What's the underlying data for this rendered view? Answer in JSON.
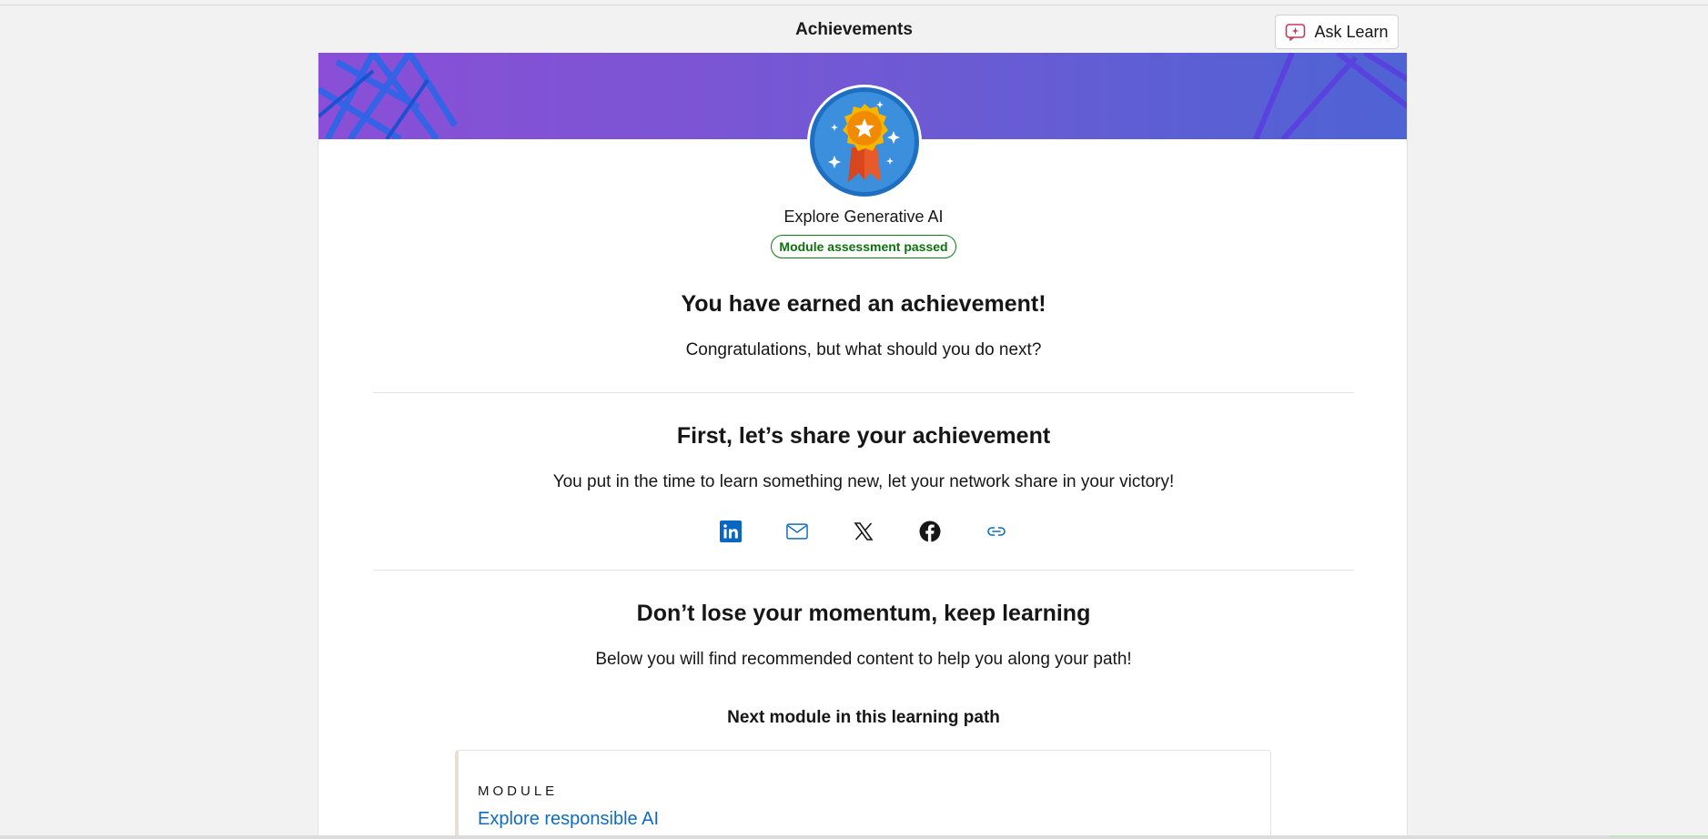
{
  "header": {
    "title": "Achievements",
    "ask_learn_label": "Ask Learn"
  },
  "achievement": {
    "module_name": "Explore Generative AI",
    "status": "Module assessment passed",
    "heading": "You have earned an achievement!",
    "subheading": "Congratulations, but what should you do next?"
  },
  "share": {
    "heading": "First, let’s share your achievement",
    "text": "You put in the time to learn something new, let your network share in your victory!",
    "buttons": [
      {
        "icon": "linkedin-icon",
        "color": "#0a66c2"
      },
      {
        "icon": "mail-icon",
        "color": "#0f6cbd"
      },
      {
        "icon": "x-icon",
        "color": "#161616"
      },
      {
        "icon": "facebook-icon",
        "color": "#161616"
      },
      {
        "icon": "link-icon",
        "color": "#0f6cbd"
      }
    ]
  },
  "momentum": {
    "heading": "Don’t lose your momentum, keep learning",
    "text": "Below you will find recommended content to help you along your path!",
    "next_label": "Next module in this learning path"
  },
  "next_module": {
    "type": "MODULE",
    "title": "Explore responsible AI"
  },
  "colors": {
    "accent": "#0f6cbd",
    "success": "#107c10",
    "banner_start": "#8a4fd6",
    "banner_end": "#4e63d4"
  }
}
